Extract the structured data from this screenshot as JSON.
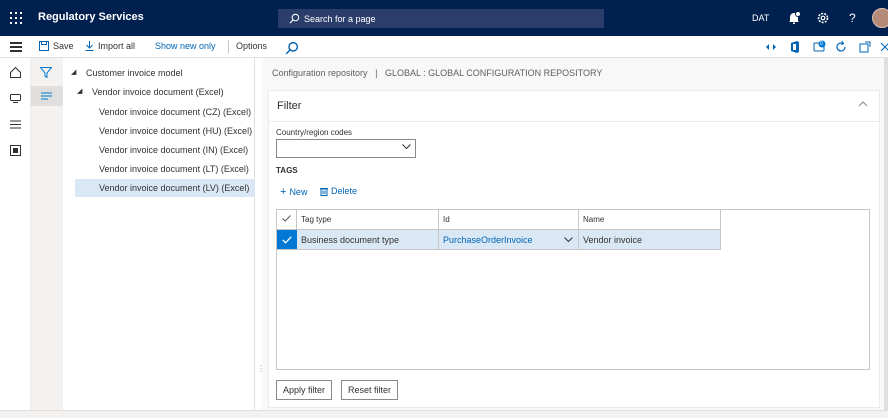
{
  "header": {
    "app_title": "Regulatory Services",
    "search_placeholder": "Search for a page",
    "company": "DAT",
    "icons": [
      "waffle-icon",
      "search-icon",
      "notification-icon",
      "settings-icon",
      "help-icon",
      "avatar"
    ]
  },
  "actionpane": {
    "save": "Save",
    "import_all": "Import all",
    "show_new_only": "Show new only",
    "options": "Options",
    "badge_count": "0"
  },
  "tree": {
    "items": [
      {
        "label": "Customer invoice model",
        "expanded": true
      },
      {
        "label": "Vendor invoice document (Excel)",
        "expanded": true
      },
      {
        "label": "Vendor invoice document (CZ) (Excel)"
      },
      {
        "label": "Vendor invoice document (HU) (Excel)"
      },
      {
        "label": "Vendor invoice document (IN) (Excel)"
      },
      {
        "label": "Vendor invoice document (LT) (Excel)"
      },
      {
        "label": "Vendor invoice document (LV) (Excel)",
        "selected": true
      }
    ]
  },
  "breadcrumb": {
    "part1": "Configuration repository",
    "separator": "|",
    "part2": "GLOBAL : GLOBAL CONFIGURATION REPOSITORY"
  },
  "filter": {
    "title": "Filter",
    "country_label": "Country/region codes",
    "country_value": "",
    "tags_header": "TAGS",
    "new_label": "New",
    "delete_label": "Delete",
    "grid": {
      "columns": [
        "Tag type",
        "Id",
        "Name"
      ],
      "rows": [
        {
          "checked": true,
          "tag_type": "Business document type",
          "id": "PurchaseOrderInvoice",
          "name": "Vendor invoice"
        }
      ]
    },
    "apply_button": "Apply filter",
    "reset_button": "Reset filter"
  },
  "colors": {
    "topbar": "#002050",
    "accent": "#0078d4",
    "link": "#0064b4",
    "selection": "#dae8f6"
  }
}
